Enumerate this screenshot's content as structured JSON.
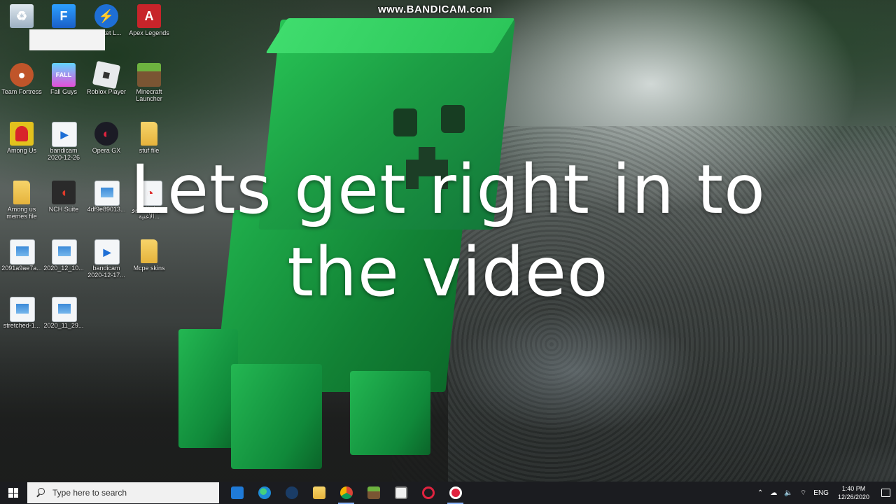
{
  "watermark": "www.BANDICAM.com",
  "caption": {
    "line1": "Lets get right in to",
    "line2": "the video"
  },
  "desktop_icons": [
    {
      "label": "",
      "icon": "recycle-bin-icon"
    },
    {
      "label": "",
      "icon": "fortnite-icon"
    },
    {
      "label": "Rocket L...",
      "icon": "rocket-league-icon"
    },
    {
      "label": "Apex Legends",
      "icon": "apex-legends-icon"
    },
    {
      "label": "Team Fortress",
      "icon": "tf2-icon"
    },
    {
      "label": "Fall Guys",
      "icon": "fall-guys-icon"
    },
    {
      "label": "Roblox Player",
      "icon": "roblox-icon"
    },
    {
      "label": "Minecraft Launcher",
      "icon": "minecraft-icon"
    },
    {
      "label": "Among Us",
      "icon": "among-us-icon"
    },
    {
      "label": "bandicam 2020-12-26",
      "icon": "video-file-icon"
    },
    {
      "label": "Opera GX",
      "icon": "opera-gx-icon"
    },
    {
      "label": "stuf file",
      "icon": "folder-icon"
    },
    {
      "label": "Among us memes file",
      "icon": "folder-icon"
    },
    {
      "label": "NCH Suite",
      "icon": "nch-suite-icon"
    },
    {
      "label": "4df9e89013...",
      "icon": "image-file-icon"
    },
    {
      "label": "تحويل الفيديو الأغنية...",
      "icon": "arabic-file-icon"
    },
    {
      "label": "2091a9ae7a...",
      "icon": "image-file-icon"
    },
    {
      "label": "2020_12_10...",
      "icon": "image-file-icon"
    },
    {
      "label": "bandicam 2020-12-17...",
      "icon": "video-file-icon"
    },
    {
      "label": "Mcpe skins",
      "icon": "folder-icon"
    },
    {
      "label": "stretched-1...",
      "icon": "image-file-icon"
    },
    {
      "label": "2020_11_29...",
      "icon": "image-file-icon"
    }
  ],
  "taskbar": {
    "search_placeholder": "Type here to search",
    "apps": [
      "mail-icon",
      "edge-icon",
      "steam-icon",
      "file-explorer-icon",
      "chrome-icon",
      "minecraft-icon",
      "store-icon",
      "opera-icon",
      "bandicam-record-icon"
    ],
    "tray": {
      "language": "ENG",
      "time": "1:40 PM",
      "date": "12/26/2020"
    }
  }
}
